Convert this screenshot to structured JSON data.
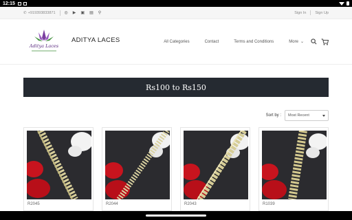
{
  "status_bar": {
    "time": "12:15"
  },
  "topbar": {
    "phone": "+919393833871",
    "social_icons": [
      "whatsapp-icon",
      "youtube-icon",
      "instagram-icon",
      "linkedin-icon",
      "location-pin-icon"
    ],
    "sign_in": "Sign In",
    "sign_up": "Sign Up"
  },
  "header": {
    "brand_name": "ADITYA LACES",
    "logo_script": "Aditya Laces",
    "nav": [
      "All Categories",
      "Contact",
      "Terms and Conditions"
    ],
    "more_label": "More"
  },
  "banner": {
    "title": "Rs100 to Rs150"
  },
  "sort": {
    "label": "Sort by :",
    "selected": "Most Recent"
  },
  "products": [
    {
      "name": "R2045"
    },
    {
      "name": "R2044"
    },
    {
      "name": "R2043"
    },
    {
      "name": "R1039"
    }
  ],
  "colors": {
    "banner_bg": "#252a31",
    "logo_purple": "#7b3fa0",
    "logo_green": "#3f8f3a"
  }
}
